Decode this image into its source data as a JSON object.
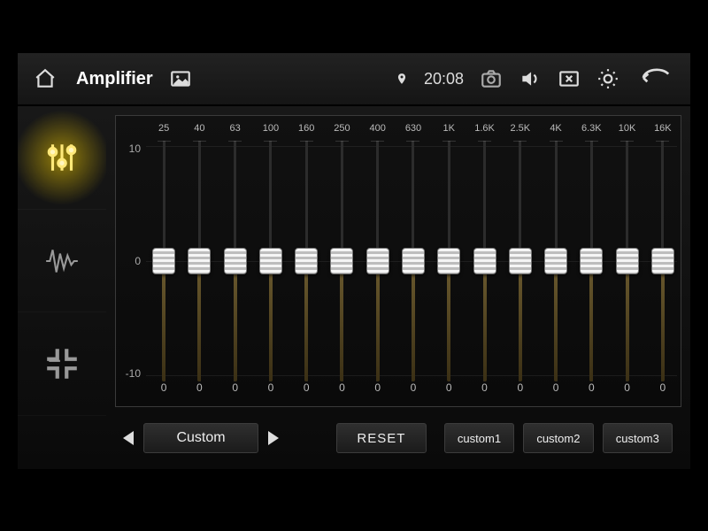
{
  "statusbar": {
    "title": "Amplifier",
    "time": "20:08"
  },
  "eq": {
    "scale": {
      "max": "10",
      "mid": "0",
      "min": "-10"
    },
    "bands": [
      {
        "freq": "25",
        "value": "0"
      },
      {
        "freq": "40",
        "value": "0"
      },
      {
        "freq": "63",
        "value": "0"
      },
      {
        "freq": "100",
        "value": "0"
      },
      {
        "freq": "160",
        "value": "0"
      },
      {
        "freq": "250",
        "value": "0"
      },
      {
        "freq": "400",
        "value": "0"
      },
      {
        "freq": "630",
        "value": "0"
      },
      {
        "freq": "1K",
        "value": "0"
      },
      {
        "freq": "1.6K",
        "value": "0"
      },
      {
        "freq": "2.5K",
        "value": "0"
      },
      {
        "freq": "4K",
        "value": "0"
      },
      {
        "freq": "6.3K",
        "value": "0"
      },
      {
        "freq": "10K",
        "value": "0"
      },
      {
        "freq": "16K",
        "value": "0"
      }
    ]
  },
  "bottom": {
    "preset_name": "Custom",
    "reset": "RESET",
    "slots": [
      "custom1",
      "custom2",
      "custom3"
    ]
  }
}
